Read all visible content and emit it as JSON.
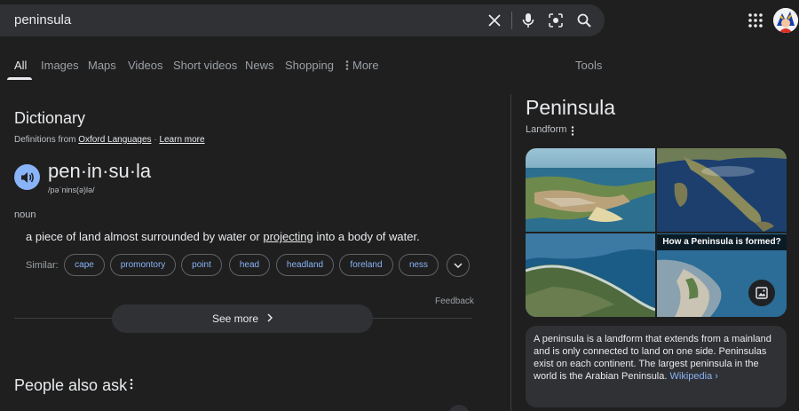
{
  "search": {
    "query": "peninsula"
  },
  "tabs": [
    {
      "label": "All"
    },
    {
      "label": "Images"
    },
    {
      "label": "Maps"
    },
    {
      "label": "Videos"
    },
    {
      "label": "Short videos"
    },
    {
      "label": "News"
    },
    {
      "label": "Shopping"
    },
    {
      "label": "More"
    }
  ],
  "tools_label": "Tools",
  "dictionary": {
    "title": "Dictionary",
    "source_prefix": "Definitions from",
    "source_name": "Oxford Languages",
    "learn_more": "Learn more",
    "word": "pen·in·su·la",
    "phonetic": "/pəˈnins(ə)lə/",
    "part_of_speech": "noun",
    "definition_before": "a piece of land almost surrounded by water or ",
    "definition_link": "projecting",
    "definition_after": " into a body of water.",
    "similar_label": "Similar:",
    "similar": [
      "cape",
      "promontory",
      "point",
      "head",
      "headland",
      "foreland",
      "ness"
    ],
    "feedback": "Feedback",
    "see_more": "See more"
  },
  "people_also_ask": "People also ask",
  "knowledge_panel": {
    "title": "Peninsula",
    "subtitle": "Landform",
    "image_caption": "How a Peninsula is formed?",
    "description": "A peninsula is a landform that extends from a mainland and is only connected to land on one side. Peninsulas exist on each continent. The largest peninsula in the world is the Arabian Peninsula.",
    "source_link": "Wikipedia ›"
  },
  "colors": {
    "background": "#1f1f1f",
    "surface": "#303134",
    "accent": "#8ab4f8",
    "text": "#e8eaed",
    "muted": "#9aa0a6"
  },
  "icons": [
    "clear-icon",
    "microphone-icon",
    "lens-icon",
    "search-icon",
    "apps-grid-icon",
    "speaker-icon",
    "chevron-down-icon",
    "chevron-right-icon",
    "more-vert-icon",
    "image-icon"
  ]
}
